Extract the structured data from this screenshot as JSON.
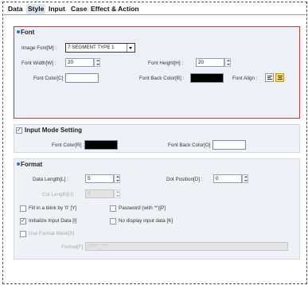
{
  "tabs": [
    "Data",
    "Style",
    "Input",
    "Case",
    "Effect & Action"
  ],
  "active_tab": "Style",
  "font": {
    "title": "Font",
    "image_font_label": "Image Font[M] :",
    "image_font_value": "7 SEGMENT TYPE 1",
    "font_width_label": "Font Width[W] :",
    "font_width_value": "20",
    "font_height_label": "Font Height[H] :",
    "font_height_value": "20",
    "font_color_label": "Font Color[C] :",
    "font_color": "#ffffff",
    "font_back_color_label": "Font Back Color[B] :",
    "font_back_color": "#000000",
    "font_align_label": "Font Align :"
  },
  "input_mode": {
    "title": "Input Mode Setting",
    "checked": true,
    "font_color_label": "Font Color[R] :",
    "font_color": "#000000",
    "font_back_color_label": "Font Back Color[O] :",
    "font_back_color": "#ffffff"
  },
  "format": {
    "title": "Format",
    "data_length_label": "Data Length[L] :",
    "data_length_value": "5",
    "dot_position_label": "Dot Position[D] :",
    "dot_position_value": "0",
    "cut_length_label": "Cut Length[U] :",
    "cut_length_value": "0",
    "fill_blank_label": "Fill in a blink by '0' [Y]",
    "fill_blank_checked": false,
    "password_label": "Password (with '*')[P]",
    "password_checked": false,
    "init_input_label": "Initialize Input Data [I]",
    "init_input_checked": true,
    "no_display_label": "No display input data  [K]",
    "no_display_checked": false,
    "use_mask_label": "Use Format Mask[S]",
    "use_mask_checked": false,
    "format_label": "Format[F] :",
    "format_value": "[Y]'**_'***"
  }
}
